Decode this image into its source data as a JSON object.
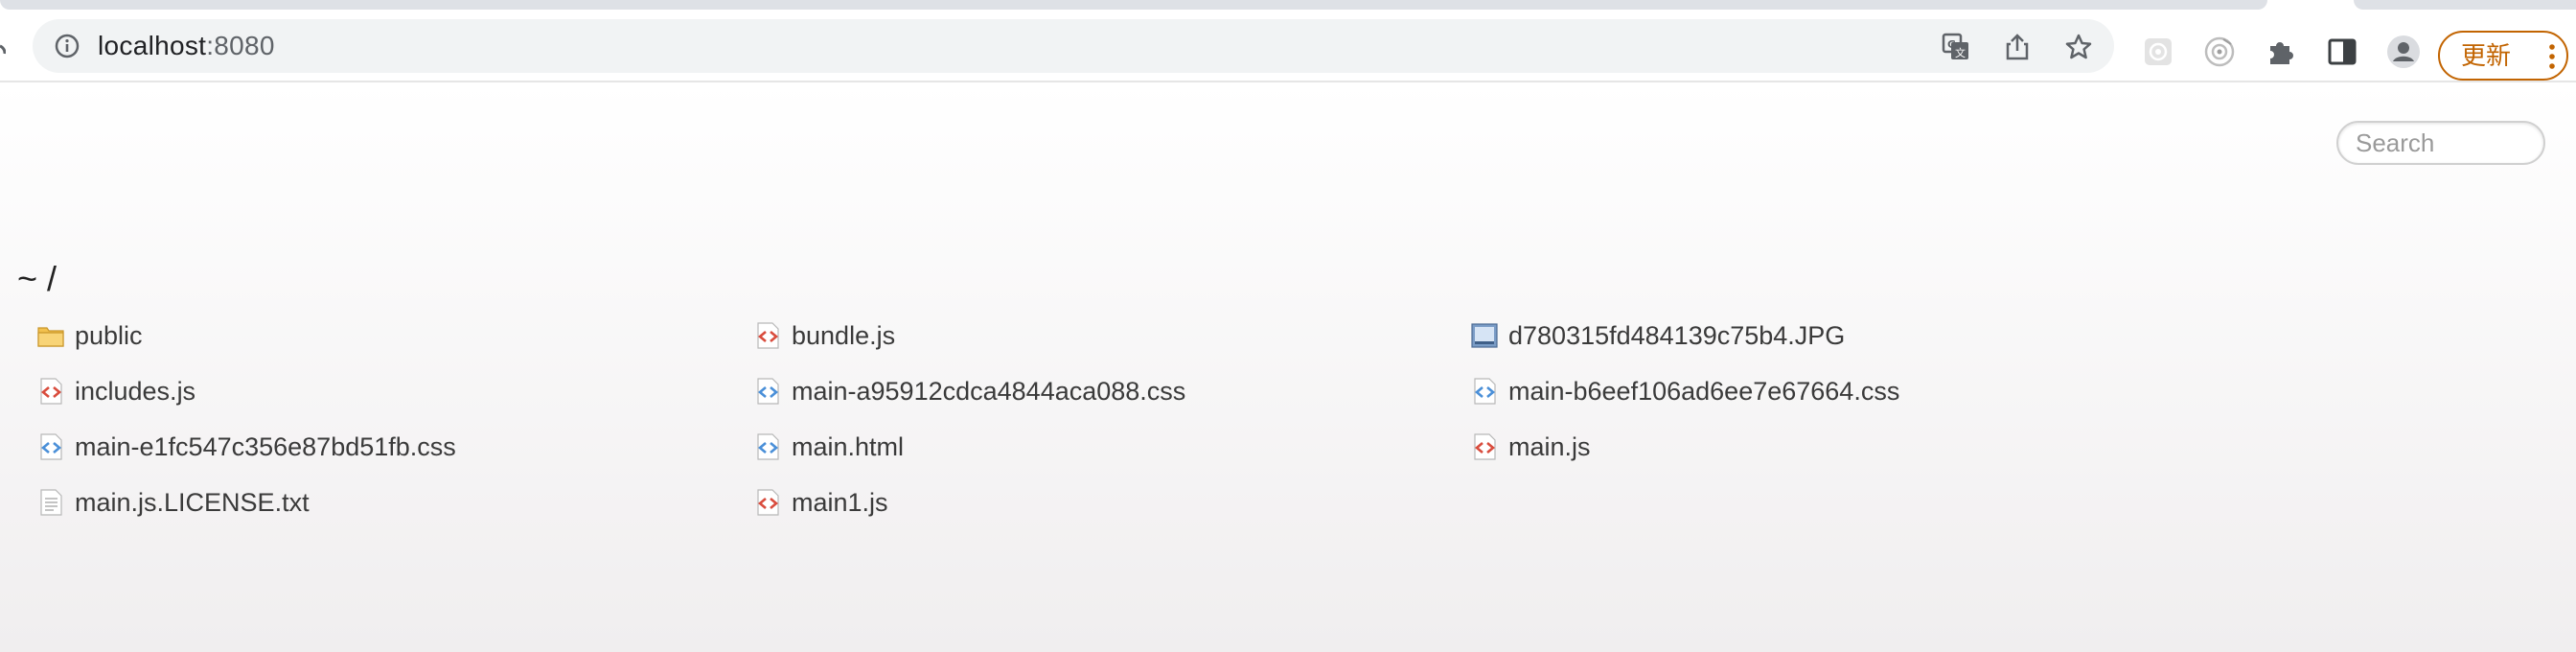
{
  "browser": {
    "address": {
      "host": "localhost",
      "port": ":8080"
    },
    "update_button_label": "更新",
    "icons": {
      "site_info": "info-icon",
      "translate": "translate-icon",
      "share": "share-icon",
      "bookmark": "star-icon",
      "ext1": "extension-disabled-icon",
      "ext2": "extension-circle-icon",
      "extensions": "puzzle-icon",
      "side_panel": "side-panel-icon",
      "profile": "profile-icon",
      "menu": "more-vert-icon"
    }
  },
  "page": {
    "search": {
      "placeholder": "Search",
      "value": ""
    },
    "breadcrumb": {
      "home": "~",
      "separator": "/"
    },
    "files": [
      {
        "name": "public",
        "type": "folder"
      },
      {
        "name": "bundle.js",
        "type": "js"
      },
      {
        "name": "d780315fd484139c75b4.JPG",
        "type": "image"
      },
      {
        "name": "includes.js",
        "type": "js"
      },
      {
        "name": "main-a95912cdca4844aca088.css",
        "type": "css"
      },
      {
        "name": "main-b6eef106ad6ee7e67664.css",
        "type": "css"
      },
      {
        "name": "main-e1fc547c356e87bd51fb.css",
        "type": "css"
      },
      {
        "name": "main.html",
        "type": "html"
      },
      {
        "name": "main.js",
        "type": "js"
      },
      {
        "name": "main.js.LICENSE.txt",
        "type": "text"
      },
      {
        "name": "main1.js",
        "type": "js"
      }
    ]
  },
  "colors": {
    "accent_update": "#c26401",
    "js_icon": "#d94c3d",
    "css_icon": "#4a8fd8",
    "folder_icon": "#f2c14e",
    "text": "#3a3a3a"
  }
}
